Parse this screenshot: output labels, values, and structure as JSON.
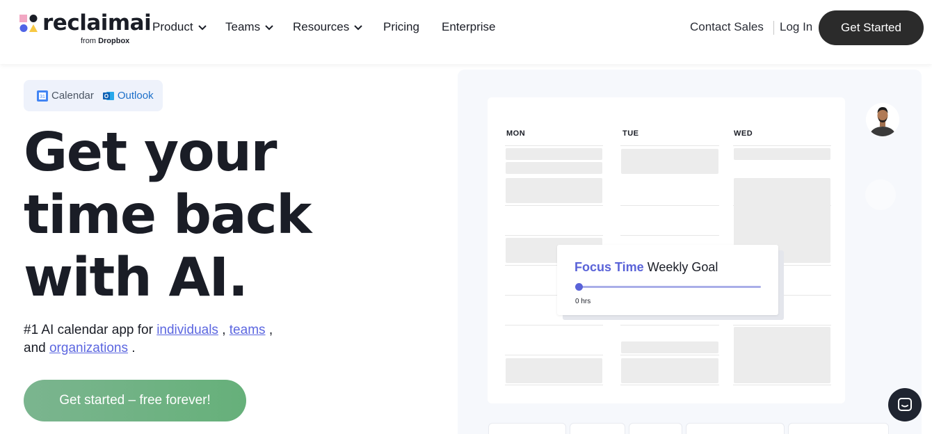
{
  "brand": {
    "name": "reclaimai",
    "sub_prefix": "from",
    "sub_brand": "Dropbox",
    "colors": {
      "pink": "#f2a7c3",
      "navy": "#1a1d26",
      "blue": "#4f63e6",
      "yellow": "#f7c843"
    }
  },
  "nav": {
    "items": [
      {
        "label": "Product",
        "has_dropdown": true
      },
      {
        "label": "Teams",
        "has_dropdown": true
      },
      {
        "label": "Resources",
        "has_dropdown": true
      },
      {
        "label": "Pricing",
        "has_dropdown": false
      },
      {
        "label": "Enterprise",
        "has_dropdown": false
      }
    ],
    "contact_sales": "Contact Sales",
    "login": "Log In",
    "get_started": "Get Started"
  },
  "integrations": {
    "calendar_label": "Calendar",
    "calendar_icon_text": "31",
    "outlook_label": "Outlook",
    "outlook_icon_text": "O"
  },
  "hero": {
    "headline_line1": "Get your",
    "headline_line2": "time back",
    "headline_line3": "with AI.",
    "subtitle_prefix": "#1 AI calendar app for",
    "link_individuals": "individuals",
    "sep1": ",",
    "link_teams": "teams",
    "sep2": ",",
    "and_text": "and",
    "link_organizations": "organizations",
    "end": ".",
    "cta": "Get started – free forever!"
  },
  "calendar": {
    "days": [
      "MON",
      "TUE",
      "WED"
    ],
    "goal_card": {
      "accent": "Focus Time",
      "title": "Weekly Goal",
      "value": "0 hrs",
      "progress": 0
    }
  },
  "colors": {
    "accent": "#5a63d8",
    "cta_green": "#6fb384",
    "dark_button": "#2b2b2b",
    "link": "#5b66e0"
  }
}
